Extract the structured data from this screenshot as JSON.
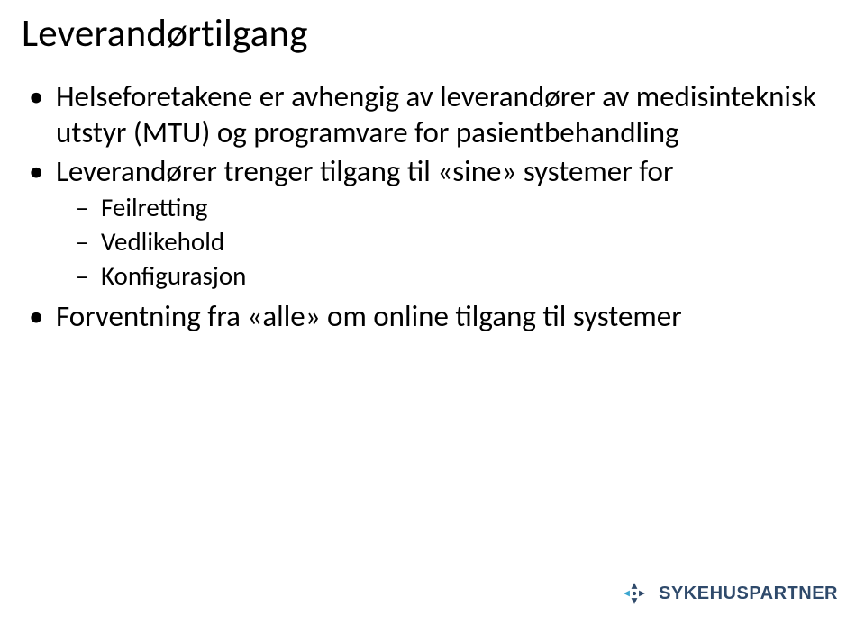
{
  "title": "Leverandørtilgang",
  "bullets": {
    "b1": "Helseforetakene er avhengig av leverandører av medisinteknisk utstyr (MTU) og programvare for pasientbehandling",
    "b2": "Leverandører trenger tilgang til «sine» systemer for",
    "b2_sub": {
      "s1": "Feilretting",
      "s2": "Vedlikehold",
      "s3": "Konfigurasjon"
    },
    "b3": "Forventning fra «alle» om online tilgang til systemer"
  },
  "logo": {
    "text": "SYKEHUSPARTNER",
    "colors": {
      "primary": "#2f4a6b",
      "accent": "#3aa6d0"
    }
  }
}
